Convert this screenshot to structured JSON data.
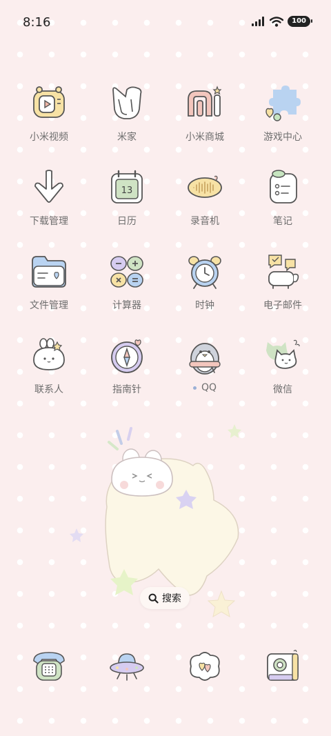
{
  "status_bar": {
    "time": "8:16",
    "battery": "100",
    "icons": [
      "signal-icon",
      "wifi-icon",
      "battery-icon"
    ]
  },
  "apps": [
    {
      "label": "小米视频",
      "icon": "video-player-icon"
    },
    {
      "label": "米家",
      "icon": "mijia-icon"
    },
    {
      "label": "小米商城",
      "icon": "mi-store-icon"
    },
    {
      "label": "游戏中心",
      "icon": "game-center-puzzle-icon"
    },
    {
      "label": "下载管理",
      "icon": "download-arrow-icon"
    },
    {
      "label": "日历",
      "icon": "calendar-icon",
      "date": "13"
    },
    {
      "label": "录音机",
      "icon": "voice-recorder-icon"
    },
    {
      "label": "笔记",
      "icon": "notes-icon"
    },
    {
      "label": "文件管理",
      "icon": "folder-icon"
    },
    {
      "label": "计算器",
      "icon": "calculator-icon"
    },
    {
      "label": "时钟",
      "icon": "alarm-clock-icon"
    },
    {
      "label": "电子邮件",
      "icon": "email-icon"
    },
    {
      "label": "联系人",
      "icon": "contacts-bunny-icon"
    },
    {
      "label": "指南针",
      "icon": "compass-icon"
    },
    {
      "label": "QQ",
      "icon": "qq-penguin-icon",
      "has_notification_dot": true
    },
    {
      "label": "微信",
      "icon": "wechat-cats-icon"
    }
  ],
  "widget": {
    "icon": "bunny-star-widget"
  },
  "search": {
    "label": "搜索",
    "icon": "search-icon"
  },
  "dock": [
    {
      "icon": "phone-icon"
    },
    {
      "icon": "ufo-browser-icon"
    },
    {
      "icon": "messages-heart-icon"
    },
    {
      "icon": "camera-icon"
    }
  ],
  "colors": {
    "background": "#fbeeee",
    "dots": "#ffffff",
    "label_text": "#6e6e6e",
    "icon_stroke": "#555555"
  }
}
